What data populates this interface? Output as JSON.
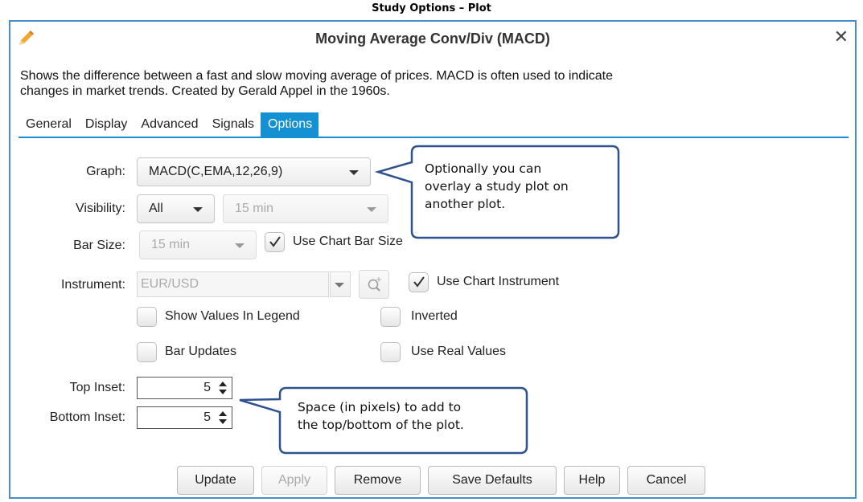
{
  "caption": "Study Options – Plot",
  "dialog": {
    "title": "Moving Average Conv/Div (MACD)",
    "description_line1": "Shows the difference between a fast and slow moving average of prices. MACD is often used to indicate",
    "description_line2": "changes in market trends.  Created by Gerald Appel in the 1960s."
  },
  "tabs": [
    {
      "label": "General"
    },
    {
      "label": "Display"
    },
    {
      "label": "Advanced"
    },
    {
      "label": "Signals"
    },
    {
      "label": "Options",
      "active": true
    }
  ],
  "form": {
    "graph_label": "Graph:",
    "graph_value": "MACD(C,EMA,12,26,9)",
    "visibility_label": "Visibility:",
    "visibility_value": "All",
    "visibility_interval": "15 min",
    "bar_size_label": "Bar Size:",
    "bar_size_value": "15 min",
    "use_chart_bar_size_label": "Use Chart Bar Size",
    "use_chart_bar_size_checked": true,
    "instrument_label": "Instrument:",
    "instrument_value": "EUR/USD",
    "use_chart_instrument_label": "Use Chart Instrument",
    "use_chart_instrument_checked": true,
    "show_values_in_legend_label": "Show Values In Legend",
    "inverted_label": "Inverted",
    "bar_updates_label": "Bar Updates",
    "use_real_values_label": "Use Real Values",
    "top_inset_label": "Top Inset:",
    "top_inset_value": "5",
    "bottom_inset_label": "Bottom Inset:",
    "bottom_inset_value": "5"
  },
  "buttons": {
    "update": "Update",
    "apply": "Apply",
    "remove": "Remove",
    "save_defaults": "Save Defaults",
    "help": "Help",
    "cancel": "Cancel"
  },
  "callouts": {
    "graph_line1": "Optionally you can",
    "graph_line2": "overlay a study plot on",
    "graph_line3": "another plot.",
    "inset_line1": "Space (in pixels) to add to",
    "inset_line2": "the top/bottom of the plot."
  },
  "colors": {
    "accent": "#1591d3",
    "dialog_border": "#4a8cc9",
    "callout_border": "#2f528f",
    "pencil": "#f0a830"
  },
  "icons": [
    "pencil-icon",
    "close-icon",
    "chevron-down-icon",
    "search-add-icon",
    "checkmark-icon",
    "spinner-arrows-icon"
  ]
}
